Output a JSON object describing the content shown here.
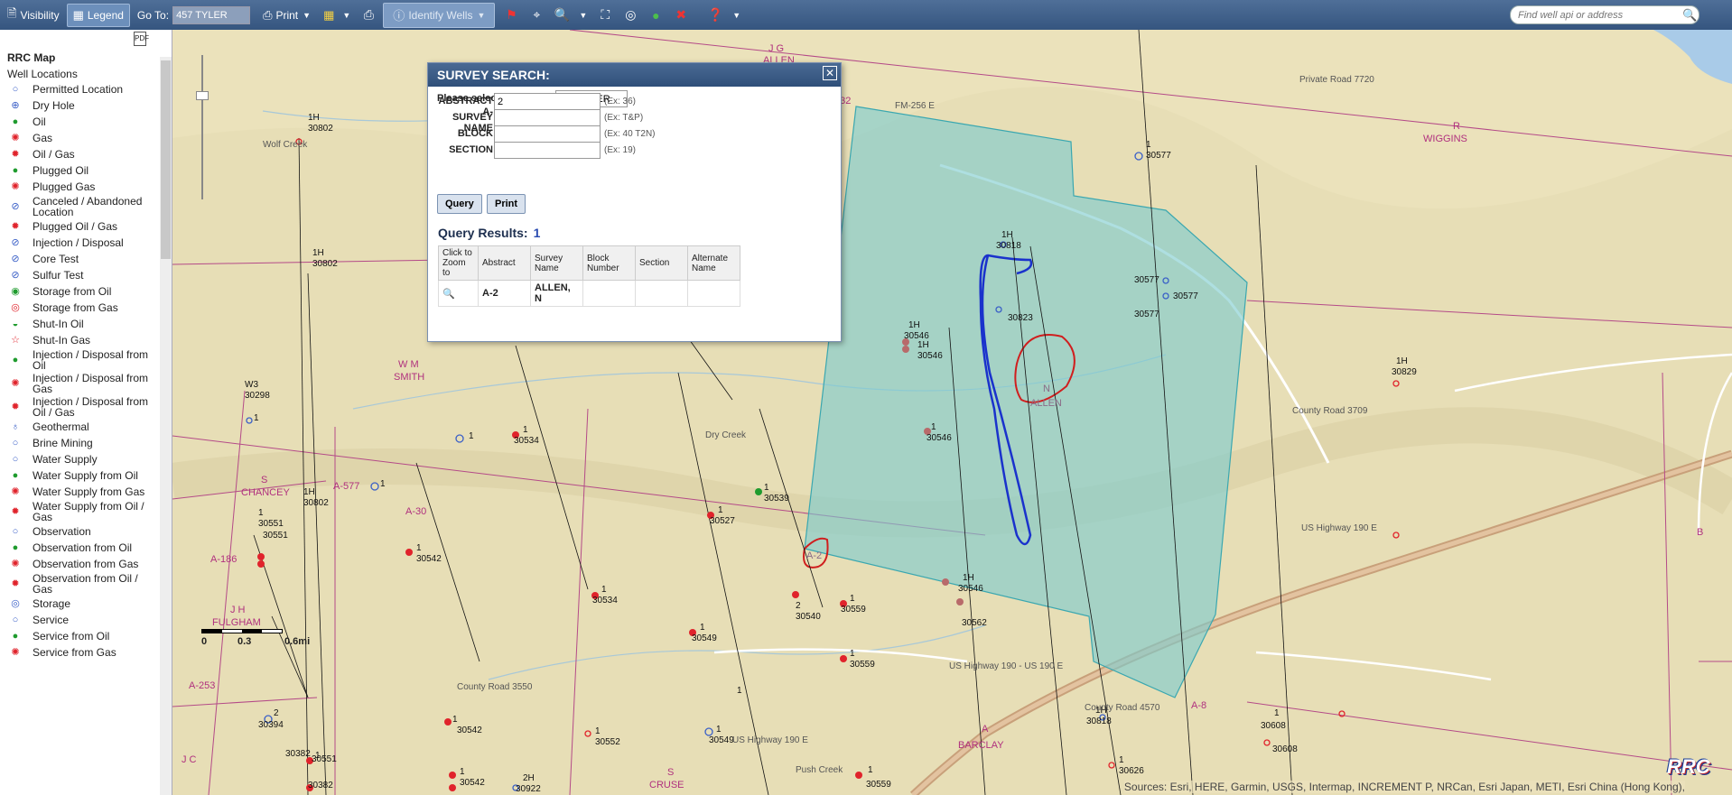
{
  "toolbar": {
    "visibility_label": "Visibility",
    "legend_label": "Legend",
    "goto_label": "Go To:",
    "goto_value": "457 TYLER",
    "print_label": "Print",
    "identify_label": "Identify Wells",
    "search_placeholder": "Find well api or address"
  },
  "legend": {
    "title": "RRC Map",
    "group": "Well Locations",
    "items": [
      {
        "label": "Permitted Location",
        "symbol": "○",
        "color": "#3a5fc7"
      },
      {
        "label": "Dry Hole",
        "symbol": "⊕",
        "color": "#3a5fc7"
      },
      {
        "label": "Oil",
        "symbol": "●",
        "color": "#1f9b2e"
      },
      {
        "label": "Gas",
        "symbol": "✺",
        "color": "#e0232b"
      },
      {
        "label": "Oil / Gas",
        "symbol": "✹",
        "color": "#e0232b"
      },
      {
        "label": "Plugged Oil",
        "symbol": "●",
        "color": "#1f9b2e"
      },
      {
        "label": "Plugged Gas",
        "symbol": "✺",
        "color": "#e0232b"
      },
      {
        "label": "Canceled / Abandoned Location",
        "symbol": "⊘",
        "color": "#3a5fc7"
      },
      {
        "label": "Plugged Oil / Gas",
        "symbol": "✹",
        "color": "#e0232b"
      },
      {
        "label": "Injection / Disposal",
        "symbol": "⊘",
        "color": "#3a5fc7"
      },
      {
        "label": "Core Test",
        "symbol": "⊘",
        "color": "#3a5fc7"
      },
      {
        "label": "Sulfur Test",
        "symbol": "⊘",
        "color": "#3a5fc7"
      },
      {
        "label": "Storage from Oil",
        "symbol": "◉",
        "color": "#1f9b2e"
      },
      {
        "label": "Storage from Gas",
        "symbol": "◎",
        "color": "#e0232b"
      },
      {
        "label": "Shut-In Oil",
        "symbol": "◒",
        "color": "#1f9b2e"
      },
      {
        "label": "Shut-In Gas",
        "symbol": "☆",
        "color": "#e0232b"
      },
      {
        "label": "Injection / Disposal from Oil",
        "symbol": "●",
        "color": "#1f9b2e"
      },
      {
        "label": "Injection / Disposal from Gas",
        "symbol": "✺",
        "color": "#e0232b"
      },
      {
        "label": "Injection / Disposal from Oil / Gas",
        "symbol": "✹",
        "color": "#e0232b"
      },
      {
        "label": "Geothermal",
        "symbol": "♁",
        "color": "#3a5fc7"
      },
      {
        "label": "Brine Mining",
        "symbol": "○",
        "color": "#3a5fc7"
      },
      {
        "label": "Water Supply",
        "symbol": "○",
        "color": "#3a5fc7"
      },
      {
        "label": "Water Supply from Oil",
        "symbol": "●",
        "color": "#1f9b2e"
      },
      {
        "label": "Water Supply from Gas",
        "symbol": "✺",
        "color": "#e0232b"
      },
      {
        "label": "Water Supply from Oil / Gas",
        "symbol": "✹",
        "color": "#e0232b"
      },
      {
        "label": "Observation",
        "symbol": "○",
        "color": "#3a5fc7"
      },
      {
        "label": "Observation from Oil",
        "symbol": "●",
        "color": "#1f9b2e"
      },
      {
        "label": "Observation from Gas",
        "symbol": "✺",
        "color": "#e0232b"
      },
      {
        "label": "Observation from Oil / Gas",
        "symbol": "✹",
        "color": "#e0232b"
      },
      {
        "label": "Storage",
        "symbol": "◎",
        "color": "#3a5fc7"
      },
      {
        "label": "Service",
        "symbol": "○",
        "color": "#3a5fc7"
      },
      {
        "label": "Service from Oil",
        "symbol": "●",
        "color": "#1f9b2e"
      },
      {
        "label": "Service from Gas",
        "symbol": "✺",
        "color": "#e0232b"
      }
    ]
  },
  "map": {
    "scale": {
      "zero": "0",
      "mid": "0.3",
      "end": "0.6mi"
    },
    "attribution": "Sources: Esri, HERE, Garmin, USGS, Intermap, INCREMENT P, NRCan, Esri Japan, METI, Esri China (Hong Kong),",
    "logo_text": "RRC"
  },
  "dialog": {
    "title": "SURVEY SEARCH:",
    "county_label": "Please select a county:",
    "county_value": "457 TYLER",
    "fields": [
      {
        "label": "ABSTRACT A-",
        "value": "2",
        "example": "(Ex: 36)"
      },
      {
        "label": "SURVEY NAME",
        "value": "",
        "example": "(Ex: T&P)"
      },
      {
        "label": "BLOCK",
        "value": "",
        "example": "(Ex: 40 T2N)"
      },
      {
        "label": "SECTION",
        "value": "",
        "example": "(Ex: 19)"
      }
    ],
    "query_label": "Query",
    "print_label": "Print",
    "results_heading": "Query Results:",
    "results_count": "1",
    "columns": [
      "Click to Zoom to",
      "Abstract",
      "Survey Name",
      "Block Number",
      "Section",
      "Alternate Name"
    ],
    "rows": [
      {
        "abstract": "A-2",
        "survey": "ALLEN, N",
        "block": "",
        "section": "",
        "alternate": ""
      }
    ]
  }
}
